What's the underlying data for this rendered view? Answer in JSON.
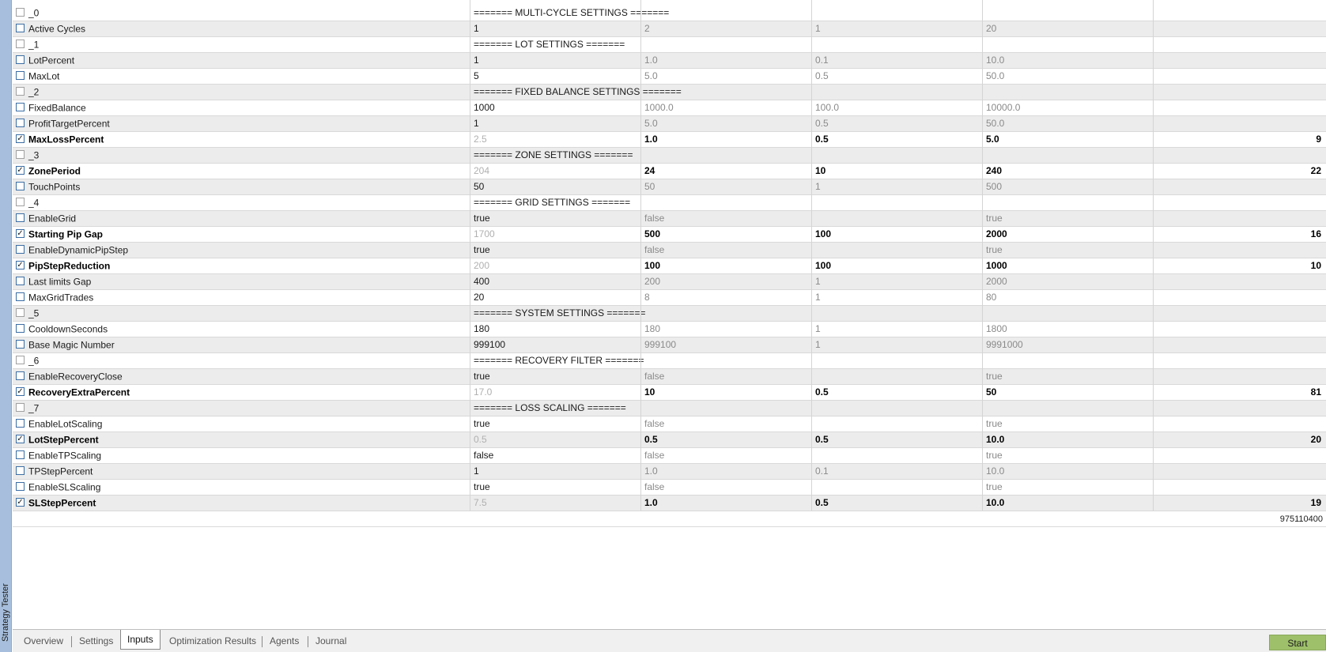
{
  "side_label": "Strategy Tester",
  "rows": [
    {
      "type": "section",
      "name": "_0",
      "title": "======= MULTI-CYCLE SETTINGS ======="
    },
    {
      "type": "param",
      "name": "Active Cycles",
      "value": "1",
      "start": "2",
      "step": "1",
      "stop": "20",
      "steps": "",
      "checked": false
    },
    {
      "type": "section",
      "name": "_1",
      "title": "======= LOT SETTINGS ======="
    },
    {
      "type": "param",
      "name": "LotPercent",
      "value": "1",
      "start": "1.0",
      "step": "0.1",
      "stop": "10.0",
      "steps": "",
      "checked": false
    },
    {
      "type": "param",
      "name": "MaxLot",
      "value": "5",
      "start": "5.0",
      "step": "0.5",
      "stop": "50.0",
      "steps": "",
      "checked": false
    },
    {
      "type": "section",
      "name": "_2",
      "title": "======= FIXED BALANCE SETTINGS ======="
    },
    {
      "type": "param",
      "name": "FixedBalance",
      "value": "1000",
      "start": "1000.0",
      "step": "100.0",
      "stop": "10000.0",
      "steps": "",
      "checked": false
    },
    {
      "type": "param",
      "name": "ProfitTargetPercent",
      "value": "1",
      "start": "5.0",
      "step": "0.5",
      "stop": "50.0",
      "steps": "",
      "checked": false
    },
    {
      "type": "param",
      "name": "MaxLossPercent",
      "value": "2.5",
      "start": "1.0",
      "step": "0.5",
      "stop": "5.0",
      "steps": "9",
      "checked": true
    },
    {
      "type": "section",
      "name": "_3",
      "title": "======= ZONE SETTINGS ======="
    },
    {
      "type": "param",
      "name": "ZonePeriod",
      "value": "204",
      "start": "24",
      "step": "10",
      "stop": "240",
      "steps": "22",
      "checked": true
    },
    {
      "type": "param",
      "name": "TouchPoints",
      "value": "50",
      "start": "50",
      "step": "1",
      "stop": "500",
      "steps": "",
      "checked": false
    },
    {
      "type": "section",
      "name": "_4",
      "title": "======= GRID SETTINGS ======="
    },
    {
      "type": "param",
      "name": "EnableGrid",
      "value": "true",
      "start": "false",
      "step": "",
      "stop": "true",
      "steps": "",
      "checked": false
    },
    {
      "type": "param",
      "name": "Starting Pip Gap",
      "value": "1700",
      "start": "500",
      "step": "100",
      "stop": "2000",
      "steps": "16",
      "checked": true
    },
    {
      "type": "param",
      "name": "EnableDynamicPipStep",
      "value": "true",
      "start": "false",
      "step": "",
      "stop": "true",
      "steps": "",
      "checked": false
    },
    {
      "type": "param",
      "name": "PipStepReduction",
      "value": "200",
      "start": "100",
      "step": "100",
      "stop": "1000",
      "steps": "10",
      "checked": true
    },
    {
      "type": "param",
      "name": "Last limits Gap",
      "value": "400",
      "start": "200",
      "step": "1",
      "stop": "2000",
      "steps": "",
      "checked": false
    },
    {
      "type": "param",
      "name": "MaxGridTrades",
      "value": "20",
      "start": "8",
      "step": "1",
      "stop": "80",
      "steps": "",
      "checked": false
    },
    {
      "type": "section",
      "name": "_5",
      "title": "======= SYSTEM SETTINGS ======="
    },
    {
      "type": "param",
      "name": "CooldownSeconds",
      "value": "180",
      "start": "180",
      "step": "1",
      "stop": "1800",
      "steps": "",
      "checked": false
    },
    {
      "type": "param",
      "name": "Base Magic Number",
      "value": "999100",
      "start": "999100",
      "step": "1",
      "stop": "9991000",
      "steps": "",
      "checked": false
    },
    {
      "type": "section",
      "name": "_6",
      "title": "======= RECOVERY FILTER ======="
    },
    {
      "type": "param",
      "name": "EnableRecoveryClose",
      "value": "true",
      "start": "false",
      "step": "",
      "stop": "true",
      "steps": "",
      "checked": false
    },
    {
      "type": "param",
      "name": "RecoveryExtraPercent",
      "value": "17.0",
      "start": "10",
      "step": "0.5",
      "stop": "50",
      "steps": "81",
      "checked": true
    },
    {
      "type": "section",
      "name": "_7",
      "title": "======= LOSS SCALING ======="
    },
    {
      "type": "param",
      "name": "EnableLotScaling",
      "value": "true",
      "start": "false",
      "step": "",
      "stop": "true",
      "steps": "",
      "checked": false
    },
    {
      "type": "param",
      "name": "LotStepPercent",
      "value": "0.5",
      "start": "0.5",
      "step": "0.5",
      "stop": "10.0",
      "steps": "20",
      "checked": true
    },
    {
      "type": "param",
      "name": "EnableTPScaling",
      "value": "false",
      "start": "false",
      "step": "",
      "stop": "true",
      "steps": "",
      "checked": false
    },
    {
      "type": "param",
      "name": "TPStepPercent",
      "value": "1",
      "start": "1.0",
      "step": "0.1",
      "stop": "10.0",
      "steps": "",
      "checked": false
    },
    {
      "type": "param",
      "name": "EnableSLScaling",
      "value": "true",
      "start": "false",
      "step": "",
      "stop": "true",
      "steps": "",
      "checked": false
    },
    {
      "type": "param",
      "name": "SLStepPercent",
      "value": "7.5",
      "start": "1.0",
      "step": "0.5",
      "stop": "10.0",
      "steps": "19",
      "checked": true
    }
  ],
  "total_passes": "975110400",
  "tabs": [
    {
      "label": "Overview",
      "active": false
    },
    {
      "label": "Settings",
      "active": false
    },
    {
      "label": "Inputs",
      "active": true
    },
    {
      "label": "Optimization Results",
      "active": false
    },
    {
      "label": "Agents",
      "active": false
    },
    {
      "label": "Journal",
      "active": false
    }
  ],
  "start_label": "Start",
  "colors": {
    "side_strip": "#a7bfdc",
    "start_button": "#9ec06a",
    "row_alt": "#ececec",
    "checkbox_border": "#3a6ea5"
  }
}
